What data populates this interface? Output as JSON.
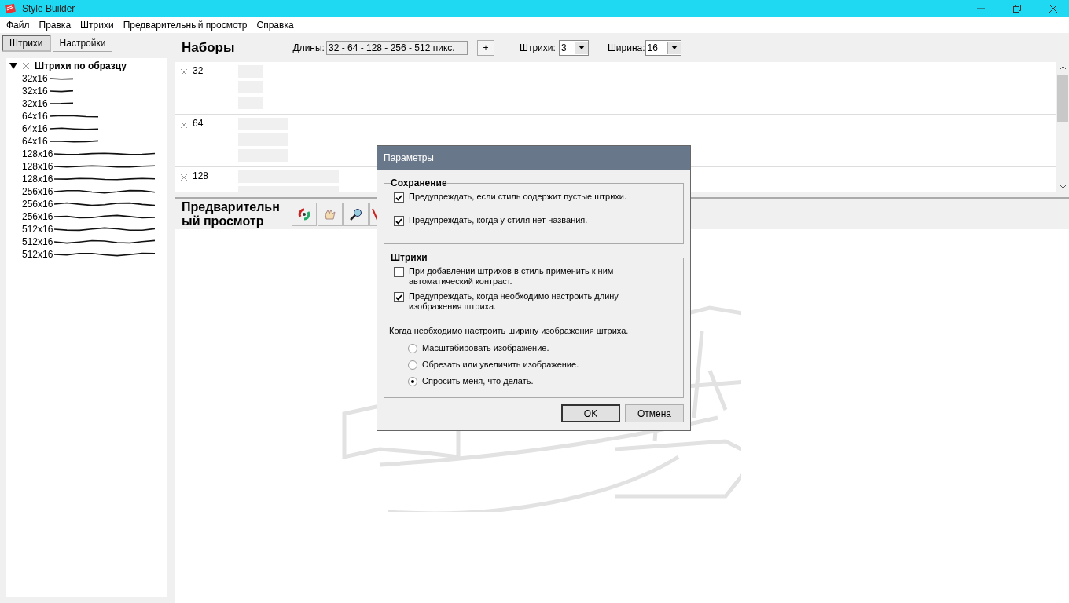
{
  "window": {
    "title": "Style Builder"
  },
  "menu": [
    "Файл",
    "Правка",
    "Штрихи",
    "Предварительный просмотр",
    "Справка"
  ],
  "left_tabs": [
    {
      "label": "Штрихи",
      "selected": true
    },
    {
      "label": "Настройки",
      "selected": false
    }
  ],
  "tree": {
    "label": "Штрихи по образцу",
    "expanded": true,
    "children": [
      {
        "label": "32x16"
      },
      {
        "label": "32x16"
      },
      {
        "label": "32x16"
      },
      {
        "label": "64x16"
      },
      {
        "label": "64x16"
      },
      {
        "label": "64x16"
      },
      {
        "label": "128x16"
      },
      {
        "label": "128x16"
      },
      {
        "label": "128x16"
      },
      {
        "label": "256x16"
      },
      {
        "label": "256x16"
      },
      {
        "label": "256x16"
      },
      {
        "label": "512x16"
      },
      {
        "label": "512x16"
      },
      {
        "label": "512x16"
      }
    ]
  },
  "sets": {
    "title": "Наборы",
    "lengths_label": "Длины:",
    "lengths_value": "32 - 64 - 128 - 256 - 512 пикс.",
    "add_button": "+",
    "strokes_label": "Штрихи:",
    "strokes_value": "3",
    "width_label": "Ширина:",
    "width_value": "16",
    "rows": [
      {
        "label": "32"
      },
      {
        "label": "64"
      },
      {
        "label": "128"
      }
    ]
  },
  "preview": {
    "title": "Предварительный просмотр"
  },
  "dialog": {
    "title": "Параметры",
    "groups": [
      {
        "title": "Сохранение",
        "items": [
          {
            "kind": "checkbox",
            "label": "Предупреждать, если стиль содержит пустые штрихи.",
            "checked": true
          },
          {
            "kind": "checkbox",
            "label": "Предупреждать, когда у стиля нет названия.",
            "checked": true
          }
        ]
      },
      {
        "title": "Штрихи",
        "items": [
          {
            "kind": "checkbox",
            "label": "При добавлении штрихов в стиль применить к ним автоматический контраст.",
            "checked": false
          },
          {
            "kind": "checkbox",
            "label": "Предупреждать, когда необходимо настроить длину изображения штриха.",
            "checked": true
          },
          {
            "kind": "note",
            "label": "Когда необходимо настроить ширину изображения штриха."
          },
          {
            "kind": "radio",
            "label": "Масштабировать изображение.",
            "selected": false
          },
          {
            "kind": "radio",
            "label": "Обрезать или увеличить изображение.",
            "selected": false
          },
          {
            "kind": "radio",
            "label": "Спросить меня, что делать.",
            "selected": true
          }
        ]
      }
    ],
    "buttons": [
      {
        "label": "OK",
        "default": true
      },
      {
        "label": "Отмена",
        "default": false
      }
    ]
  }
}
